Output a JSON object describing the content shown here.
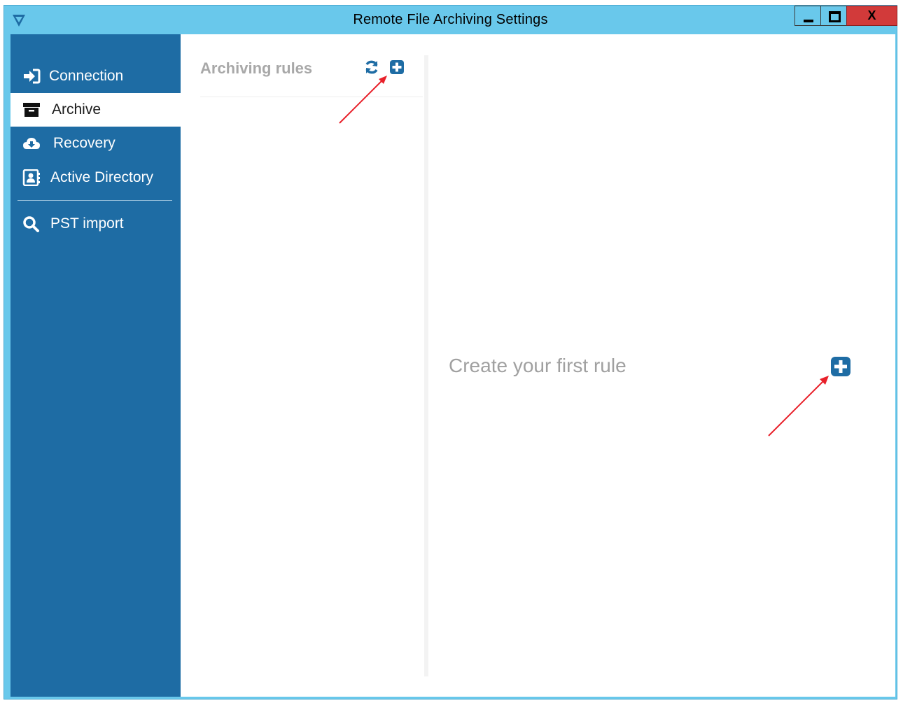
{
  "window": {
    "title": "Remote File Archiving Settings",
    "close_label": "X",
    "accent_color": "#69c8eb"
  },
  "sidebar": {
    "background": "#1e6ca4",
    "items": [
      {
        "label": "Connection",
        "icon": "sign-in-icon",
        "active": false
      },
      {
        "label": "Archive",
        "icon": "archive-box-icon",
        "active": true
      },
      {
        "label": "Recovery",
        "icon": "cloud-download-icon",
        "active": false
      },
      {
        "label": "Active Directory",
        "icon": "contact-book-icon",
        "active": false
      },
      {
        "label": "PST import",
        "icon": "search-icon",
        "active": false
      }
    ]
  },
  "rules_panel": {
    "title": "Archiving rules",
    "refresh_icon": "refresh-icon",
    "add_icon": "plus-square-icon"
  },
  "main": {
    "empty_message": "Create your first rule",
    "add_icon": "plus-square-icon"
  },
  "annotations": {
    "arrow_color": "#e8202a"
  }
}
